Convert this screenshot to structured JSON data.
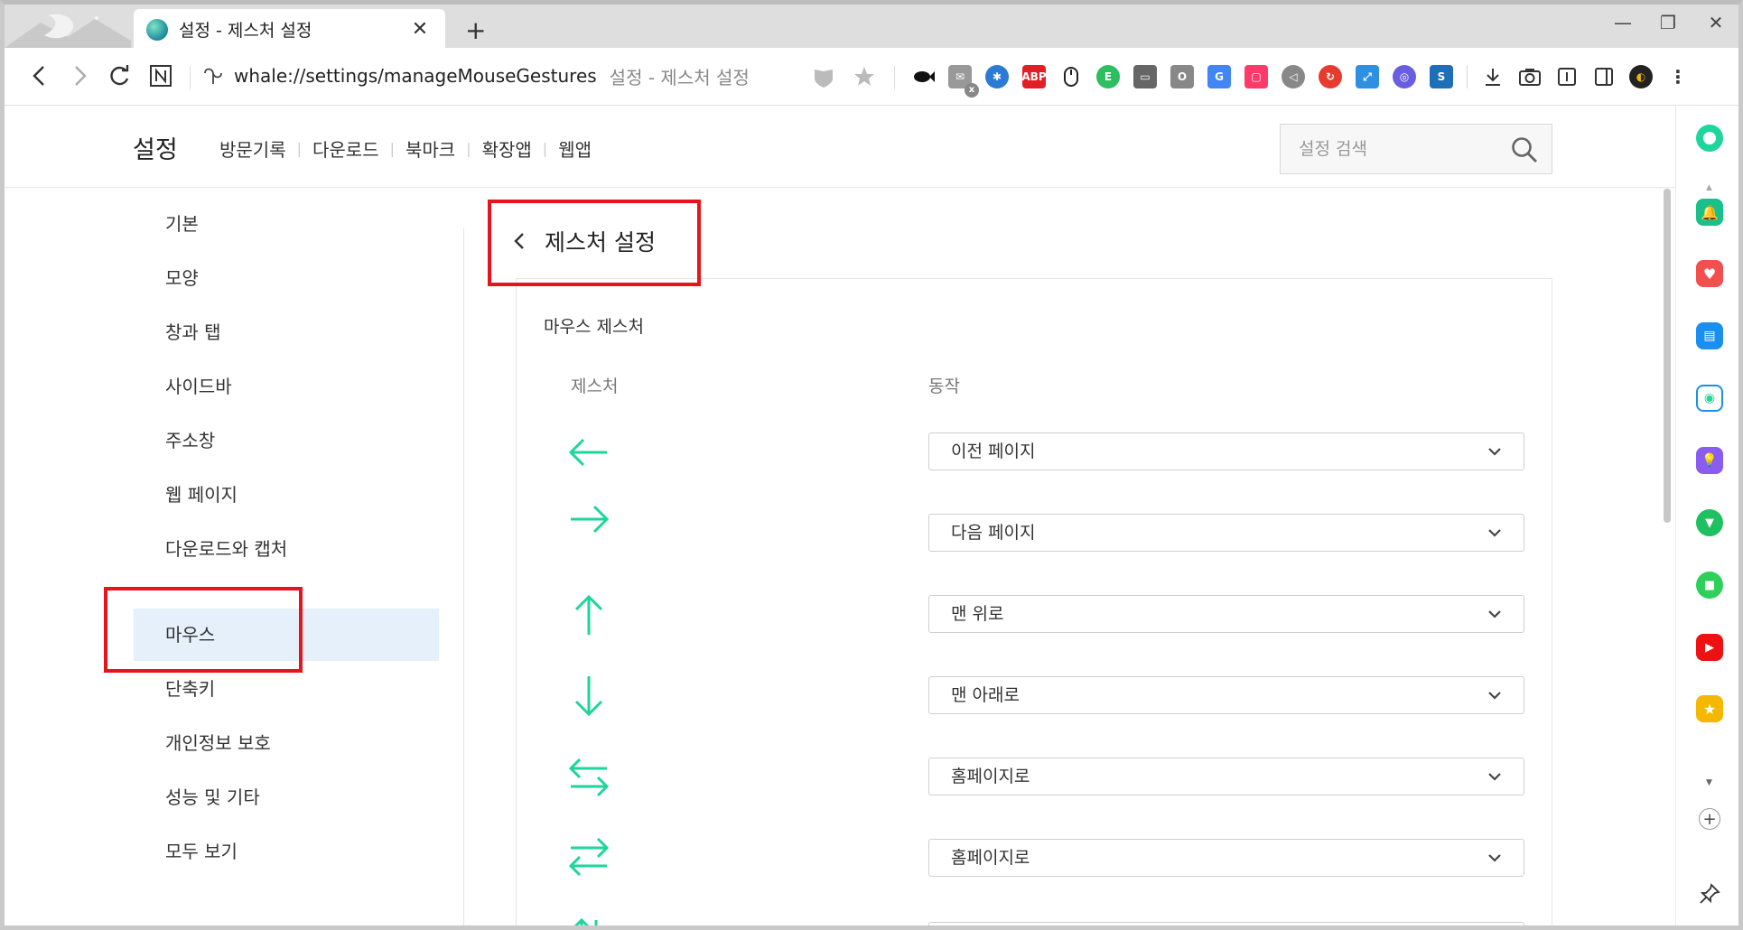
{
  "browser": {
    "tab_title": "설정 - 제스처 설정",
    "url": "whale://settings/manageMouseGestures",
    "page_title": "설정 - 제스처 설정"
  },
  "header": {
    "title": "설정",
    "links": [
      "방문기록",
      "다운로드",
      "북마크",
      "확장앱",
      "웹앱"
    ],
    "search_placeholder": "설정 검색"
  },
  "sidebar": {
    "items": [
      {
        "label": "기본"
      },
      {
        "label": "모양"
      },
      {
        "label": "창과 탭"
      },
      {
        "label": "사이드바"
      },
      {
        "label": "주소창"
      },
      {
        "label": "웹 페이지"
      },
      {
        "label": "다운로드와 캡처"
      },
      {
        "label": "마우스"
      },
      {
        "label": "단축키"
      },
      {
        "label": "개인정보 보호"
      },
      {
        "label": "성능 및 기타"
      },
      {
        "label": "모두 보기"
      }
    ],
    "active_index": 7
  },
  "main": {
    "page_heading": "제스처 설정",
    "section_title": "마우스 제스처",
    "col_gesture": "제스처",
    "col_action": "동작",
    "rows": [
      {
        "gesture": "left-arrow-icon",
        "action": "이전 페이지"
      },
      {
        "gesture": "right-arrow-icon",
        "action": "다음 페이지"
      },
      {
        "gesture": "up-arrow-icon",
        "action": "맨 위로"
      },
      {
        "gesture": "down-arrow-icon",
        "action": "맨 아래로"
      },
      {
        "gesture": "left-right-arrow-icon",
        "action": "홈페이지로"
      },
      {
        "gesture": "right-left-arrow-icon",
        "action": "홈페이지로"
      }
    ]
  },
  "extensions": {
    "abp_label": "ABP"
  },
  "colors": {
    "accent_green": "#1ed59b",
    "highlight_red": "#e8141c",
    "active_nav_bg": "#e5f0fa"
  }
}
